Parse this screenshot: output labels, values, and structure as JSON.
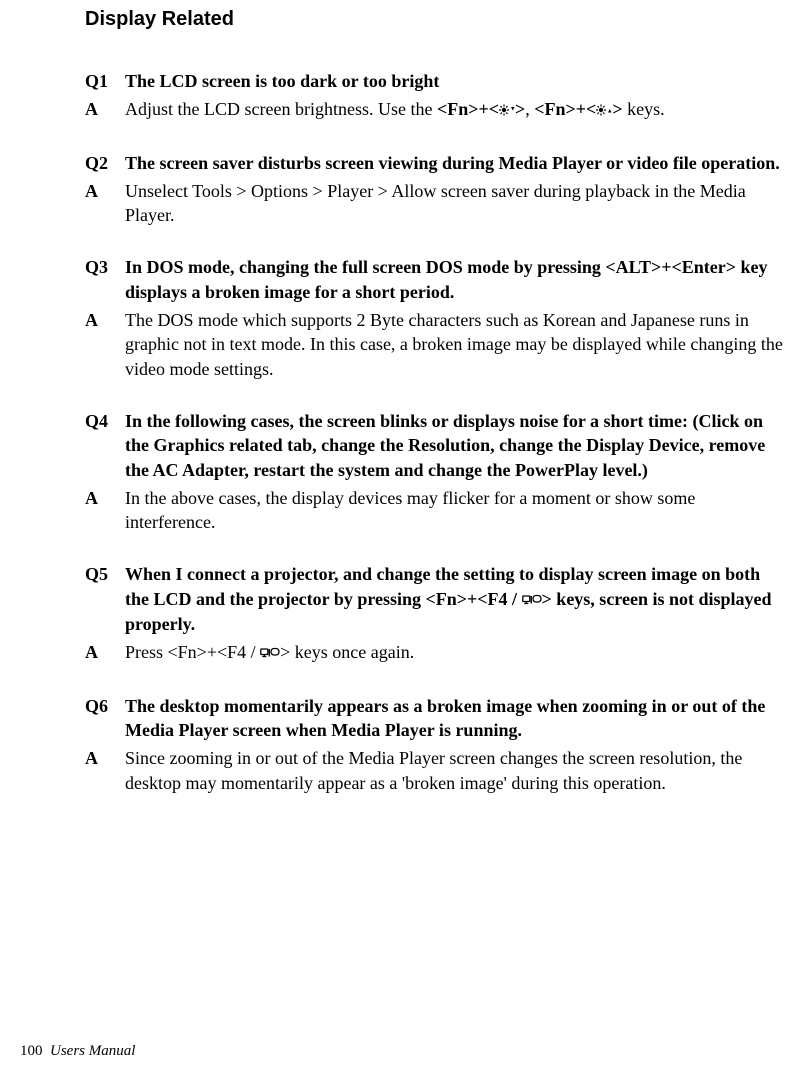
{
  "section_title": "Display Related",
  "qa": [
    {
      "q_label": "Q1",
      "q_text_plain": "The LCD screen is too dark or too bright",
      "a_label": "A",
      "a_pre": "Adjust the LCD screen brightness. Use the ",
      "a_b1": "<Fn>+<",
      "a_icon1": "brightness-down-icon",
      "a_b2": ">",
      "a_mid": ", ",
      "a_b3": "<Fn>+<",
      "a_icon2": "brightness-up-icon",
      "a_b4": ">",
      "a_post": " keys."
    },
    {
      "q_label": "Q2",
      "q_text_plain": "The screen saver disturbs screen viewing during Media Player or video file operation.",
      "a_label": "A",
      "a_text_plain": "Unselect Tools > Options > Player > Allow screen saver during playback in the Media Player."
    },
    {
      "q_label": "Q3",
      "q_text_plain": "In DOS mode, changing the full screen DOS mode by pressing <ALT>+<Enter> key displays a broken image for a short period.",
      "a_label": "A",
      "a_text_plain": "The DOS mode which supports 2 Byte characters such as Korean and Japanese runs in graphic not in text mode. In this case, a broken image may be displayed while changing the video mode settings."
    },
    {
      "q_label": "Q4",
      "q_text_plain": "In the following cases, the screen blinks or displays noise for a short time: (Click on the Graphics related tab, change the Resolution, change the Display Device, remove the AC Adapter, restart the system and change the PowerPlay level.)",
      "a_label": "A",
      "a_text_plain": "In the above cases, the display devices may flicker for a moment or show some interference."
    },
    {
      "q_label": "Q5",
      "q_pre": "When I connect a projector, and change the setting to display screen image on both the LCD and the projector by pressing <Fn>+<F4 / ",
      "q_icon": "display-switch-icon",
      "q_post": "> keys, screen is not displayed properly.",
      "a_label": "A",
      "a_pre2": "Press <Fn>+<F4 / ",
      "a_icon": "display-switch-icon",
      "a_post2": "> keys once again."
    },
    {
      "q_label": "Q6",
      "q_text_plain": "The desktop momentarily appears as a broken image when zooming in or out of the Media Player screen when Media Player is running.",
      "a_label": "A",
      "a_text_plain": "Since zooming in or out of the Media Player screen changes the screen resolution, the desktop may momentarily appear as a 'broken image' during this operation."
    }
  ],
  "footer_page": "100",
  "footer_text": "Users Manual"
}
